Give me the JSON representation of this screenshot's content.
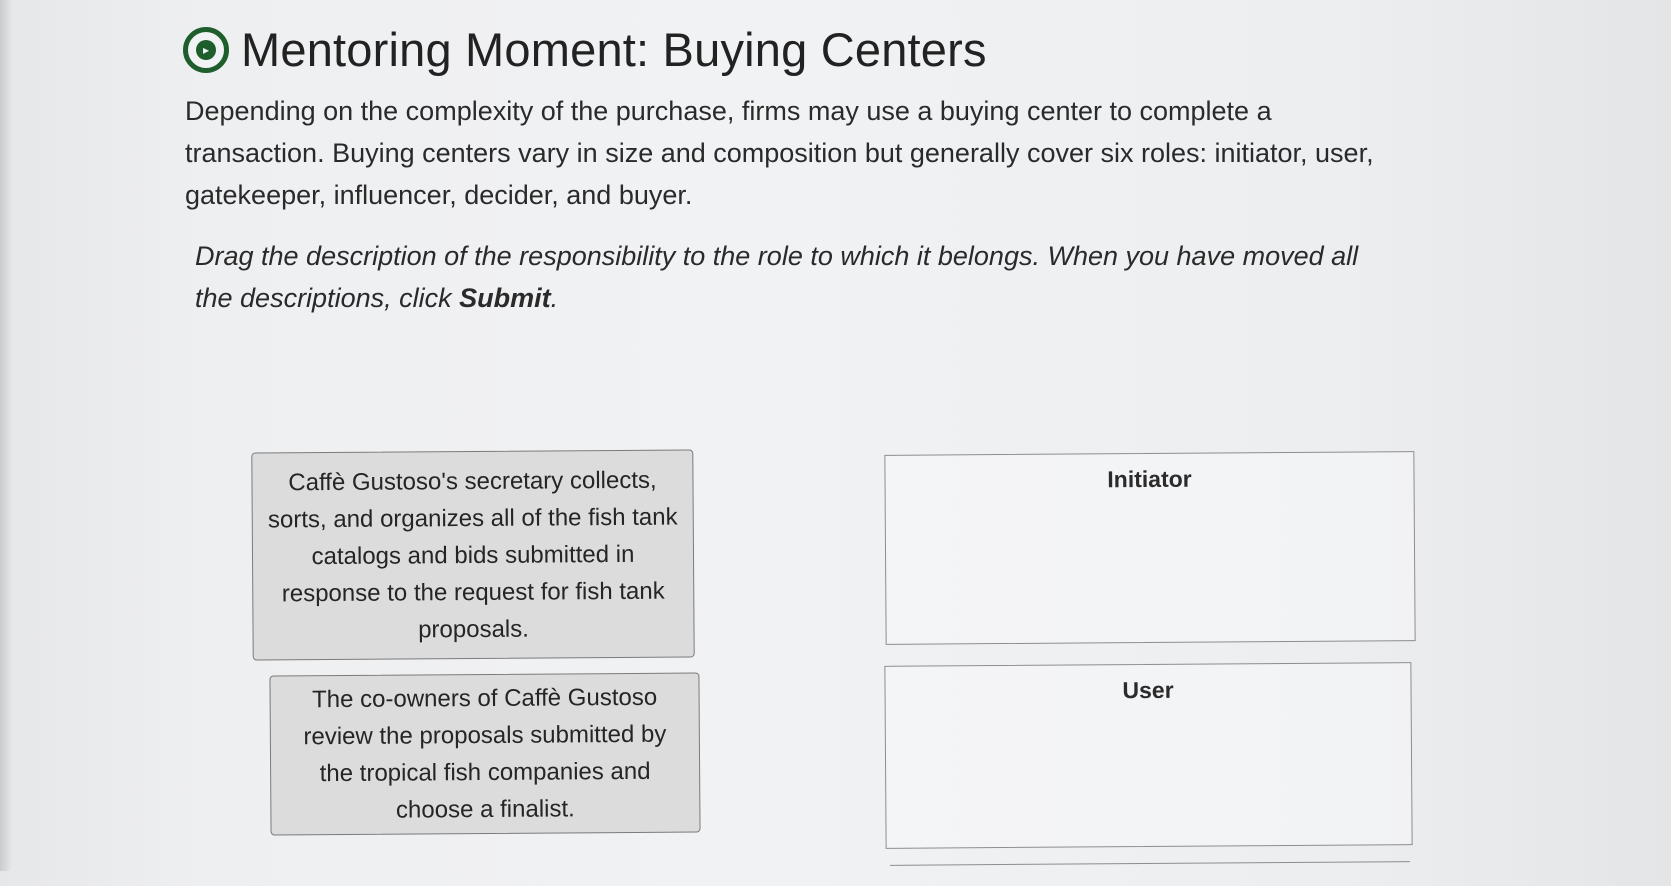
{
  "header": {
    "icon": "compass-icon",
    "title": "Mentoring Moment: Buying Centers"
  },
  "intro": "Depending on the complexity of the purchase, firms may use a buying center to complete a transaction. Buying centers vary in size and composition but generally cover six roles: initiator, user, gatekeeper, influencer, decider, and buyer.",
  "instructions": {
    "text": "Drag the description of the responsibility to the role to which it belongs. When you have moved all the descriptions, click ",
    "emphasis": "Submit",
    "end": "."
  },
  "descriptions": [
    "Caffè Gustoso's secretary collects, sorts, and organizes all of the fish tank catalogs and bids submitted in response to the request for fish tank proposals.",
    "The co-owners of Caffè Gustoso review the proposals submitted by the tropical fish companies and choose a finalist."
  ],
  "roles": [
    "Initiator",
    "User"
  ],
  "colors": {
    "accent": "#1e5d2c",
    "card_bg": "#dcdcdc"
  }
}
